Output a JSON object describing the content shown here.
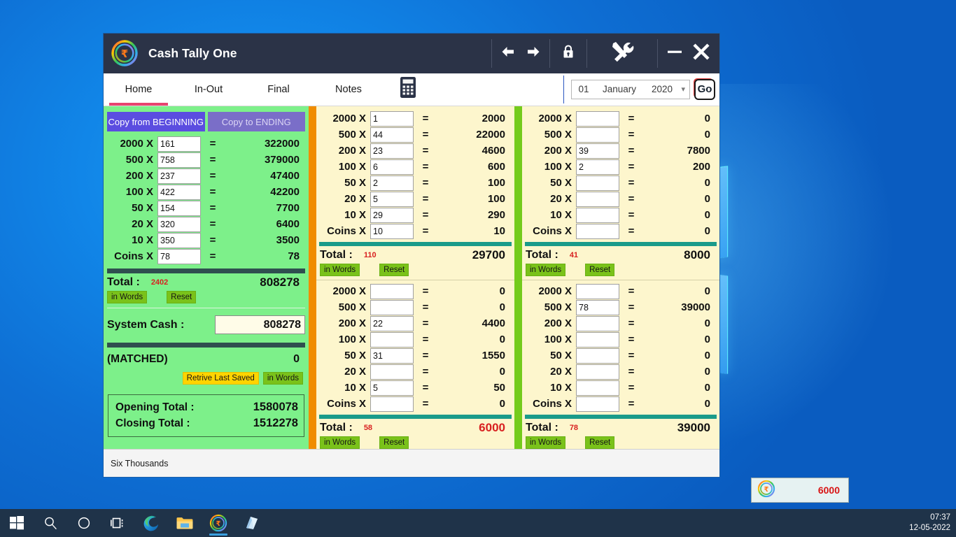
{
  "window": {
    "title": "Cash Tally One",
    "logo_icon": "rupee-circle-logo",
    "titlebar_icons": {
      "back": "arrow-left-icon",
      "forward": "arrow-right-icon",
      "lock": "lock-icon",
      "tools": "tools-icon",
      "minimize": "minimize-icon",
      "close": "close-icon"
    }
  },
  "tabs": [
    {
      "label": "Home",
      "active": true
    },
    {
      "label": "In-Out",
      "active": false
    },
    {
      "label": "Final",
      "active": false
    },
    {
      "label": "Notes",
      "active": false
    }
  ],
  "calculator_icon": "calculator-icon",
  "datepicker": {
    "day": "01",
    "month": "January",
    "year": "2020",
    "caret_icon": "chevron-down-icon",
    "go_label": "Go"
  },
  "left_panel": {
    "copy_from_beginning": "Copy from BEGINNING",
    "copy_to_ending": "Copy to ENDING",
    "rows": [
      {
        "label": "2000  X",
        "count": "161",
        "eq": "=",
        "value": "322000"
      },
      {
        "label": "500  X",
        "count": "758",
        "eq": "=",
        "value": "379000"
      },
      {
        "label": "200  X",
        "count": "237",
        "eq": "=",
        "value": "47400"
      },
      {
        "label": "100  X",
        "count": "422",
        "eq": "=",
        "value": "42200"
      },
      {
        "label": "50  X",
        "count": "154",
        "eq": "=",
        "value": "7700"
      },
      {
        "label": "20  X",
        "count": "320",
        "eq": "=",
        "value": "6400"
      },
      {
        "label": "10  X",
        "count": "350",
        "eq": "=",
        "value": "3500"
      },
      {
        "label": "Coins  X",
        "count": "78",
        "eq": "=",
        "value": "78"
      }
    ],
    "total_label": "Total :",
    "total_count": "2402",
    "total_amount": "808278",
    "in_words": "in Words",
    "reset": "Reset",
    "system_cash_label": "System Cash :",
    "system_cash_value": "808278",
    "matched_label": "(MATCHED)",
    "matched_value": "0",
    "retrieve_last_saved": "Retrive Last Saved",
    "matched_in_words": "in Words",
    "opening_total_label": "Opening Total :",
    "opening_total_value": "1580078",
    "closing_total_label": "Closing Total :",
    "closing_total_value": "1512278"
  },
  "mid_panel": {
    "top": {
      "rows": [
        {
          "label": "2000  X",
          "count": "1",
          "eq": "=",
          "value": "2000"
        },
        {
          "label": "500  X",
          "count": "44",
          "eq": "=",
          "value": "22000"
        },
        {
          "label": "200  X",
          "count": "23",
          "eq": "=",
          "value": "4600"
        },
        {
          "label": "100  X",
          "count": "6",
          "eq": "=",
          "value": "600"
        },
        {
          "label": "50  X",
          "count": "2",
          "eq": "=",
          "value": "100"
        },
        {
          "label": "20  X",
          "count": "5",
          "eq": "=",
          "value": "100"
        },
        {
          "label": "10  X",
          "count": "29",
          "eq": "=",
          "value": "290"
        },
        {
          "label": "Coins  X",
          "count": "10",
          "eq": "=",
          "value": "10"
        }
      ],
      "total_label": "Total :",
      "total_count": "110",
      "total_amount": "29700",
      "in_words": "in Words",
      "reset": "Reset"
    },
    "bottom": {
      "rows": [
        {
          "label": "2000  X",
          "count": "",
          "eq": "=",
          "value": "0"
        },
        {
          "label": "500  X",
          "count": "",
          "eq": "=",
          "value": "0"
        },
        {
          "label": "200  X",
          "count": "22",
          "eq": "=",
          "value": "4400"
        },
        {
          "label": "100  X",
          "count": "",
          "eq": "=",
          "value": "0"
        },
        {
          "label": "50  X",
          "count": "31",
          "eq": "=",
          "value": "1550"
        },
        {
          "label": "20  X",
          "count": "",
          "eq": "=",
          "value": "0"
        },
        {
          "label": "10  X",
          "count": "5",
          "eq": "=",
          "value": "50"
        },
        {
          "label": "Coins  X",
          "count": "",
          "eq": "=",
          "value": "0"
        }
      ],
      "total_label": "Total :",
      "total_count": "58",
      "total_amount": "6000",
      "in_words": "in Words",
      "reset": "Reset"
    }
  },
  "right_panel": {
    "top": {
      "rows": [
        {
          "label": "2000  X",
          "count": "",
          "eq": "=",
          "value": "0"
        },
        {
          "label": "500  X",
          "count": "",
          "eq": "=",
          "value": "0"
        },
        {
          "label": "200  X",
          "count": "39",
          "eq": "=",
          "value": "7800"
        },
        {
          "label": "100  X",
          "count": "2",
          "eq": "=",
          "value": "200"
        },
        {
          "label": "50  X",
          "count": "",
          "eq": "=",
          "value": "0"
        },
        {
          "label": "20  X",
          "count": "",
          "eq": "=",
          "value": "0"
        },
        {
          "label": "10  X",
          "count": "",
          "eq": "=",
          "value": "0"
        },
        {
          "label": "Coins  X",
          "count": "",
          "eq": "=",
          "value": "0"
        }
      ],
      "total_label": "Total :",
      "total_count": "41",
      "total_amount": "8000",
      "in_words": "in Words",
      "reset": "Reset"
    },
    "bottom": {
      "rows": [
        {
          "label": "2000  X",
          "count": "",
          "eq": "=",
          "value": "0"
        },
        {
          "label": "500  X",
          "count": "78",
          "eq": "=",
          "value": "39000"
        },
        {
          "label": "200  X",
          "count": "",
          "eq": "=",
          "value": "0"
        },
        {
          "label": "100  X",
          "count": "",
          "eq": "=",
          "value": "0"
        },
        {
          "label": "50  X",
          "count": "",
          "eq": "=",
          "value": "0"
        },
        {
          "label": "20  X",
          "count": "",
          "eq": "=",
          "value": "0"
        },
        {
          "label": "10  X",
          "count": "",
          "eq": "=",
          "value": "0"
        },
        {
          "label": "Coins  X",
          "count": "",
          "eq": "=",
          "value": "0"
        }
      ],
      "total_label": "Total :",
      "total_count": "78",
      "total_amount": "39000",
      "in_words": "in Words",
      "reset": "Reset"
    }
  },
  "statusbar": {
    "message": "Six Thousands"
  },
  "toast": {
    "icon": "rupee-circle-logo",
    "amount": "6000"
  },
  "taskbar": {
    "items": [
      {
        "icon": "windows-start-icon"
      },
      {
        "icon": "search-icon"
      },
      {
        "icon": "cortana-circle-icon"
      },
      {
        "icon": "task-view-icon"
      },
      {
        "icon": "edge-browser-icon"
      },
      {
        "icon": "file-explorer-icon"
      },
      {
        "icon": "cash-tally-app-icon"
      },
      {
        "icon": "windows-store-icon"
      }
    ],
    "time": "07:37",
    "date": "12-05-2022"
  },
  "colors": {
    "accent_pink": "#e8436f",
    "panel_green": "#7df08a",
    "panel_cream": "#fdf6cd",
    "separator_orange": "#f08c00",
    "separator_green": "#74cb1b",
    "titlebar": "#2b3347",
    "total_count_red": "#d82020"
  }
}
